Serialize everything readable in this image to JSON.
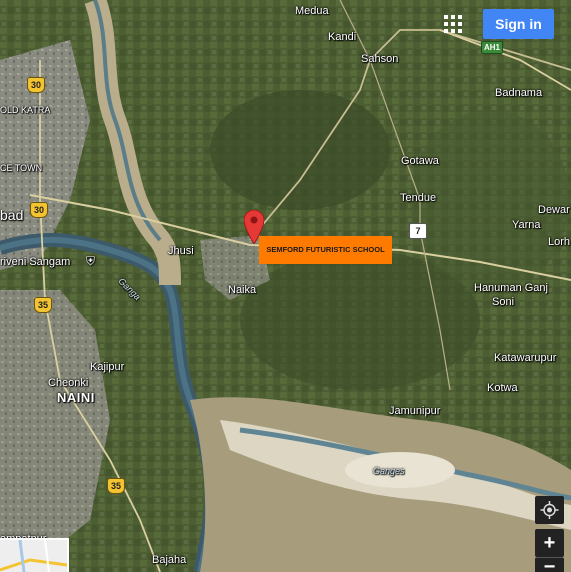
{
  "header": {
    "sign_in_label": "Sign in",
    "apps_icon": "apps-grid-icon"
  },
  "marker": {
    "label": "SEMFORD FUTURISTIC SCHOOL",
    "color": "#e53935",
    "callout_color": "#ff7b00"
  },
  "places": {
    "medua": "Medua",
    "kandi": "Kandi",
    "sahson": "Sahson",
    "badnama": "Badnama",
    "old_katra": "OLD KATRA",
    "civil_lines": "CE TOWN",
    "allahabad": "bad",
    "triveni_sangam": "riveni Sangam",
    "jhusi": "Jhusi",
    "naika": "Naika",
    "gotawa": "Gotawa",
    "tendue": "Tendue",
    "dewar": "Dewar",
    "yarna": "Yarna",
    "lorh": "Lorh",
    "hanuman_ganj": "Hanuman Ganj",
    "soni": "Soni",
    "katawarupur": "Katawarupur",
    "kotwa": "Kotwa",
    "jamunipur": "Jamunipur",
    "kajipur": "Kajipur",
    "cheonki": "Cheonki",
    "naini": "NAINI",
    "ampatpur": "ampatpur",
    "bajaha": "Bajaha",
    "ganga_label": "Ganga",
    "ganges_label": "Ganges"
  },
  "shields": {
    "nh30_top": "30",
    "nh30_mid": "30",
    "nh35_top": "35",
    "nh35_bottom": "35",
    "sh7": "7",
    "ah1": "AH1"
  },
  "controls": {
    "locate_icon": "my-location-icon",
    "zoom_in": "+",
    "zoom_out": "−"
  }
}
